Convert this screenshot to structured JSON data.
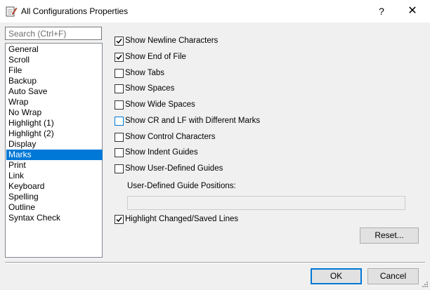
{
  "window": {
    "title": "All Configurations Properties",
    "help_glyph": "?",
    "close_glyph": "✕",
    "app_icon": "notepad-pencil-icon"
  },
  "search": {
    "placeholder": "Search (Ctrl+F)",
    "value": ""
  },
  "categories": {
    "items": [
      "General",
      "Scroll",
      "File",
      "Backup",
      "Auto Save",
      "Wrap",
      "No Wrap",
      "Highlight (1)",
      "Highlight (2)",
      "Display",
      "Marks",
      "Print",
      "Link",
      "Keyboard",
      "Spelling",
      "Outline",
      "Syntax Check"
    ],
    "selected": "Marks"
  },
  "options": [
    {
      "label": "Show Newline Characters",
      "checked": true
    },
    {
      "label": "Show End of File",
      "checked": true
    },
    {
      "label": "Show Tabs",
      "checked": false
    },
    {
      "label": "Show Spaces",
      "checked": false
    },
    {
      "label": "Show Wide Spaces",
      "checked": false
    },
    {
      "label": "Show CR and LF with Different Marks",
      "checked": false,
      "hover": true
    },
    {
      "label": "Show Control Characters",
      "checked": false
    },
    {
      "label": "Show Indent Guides",
      "checked": false
    },
    {
      "label": "Show User-Defined Guides",
      "checked": false
    }
  ],
  "guide_positions": {
    "label": "User-Defined Guide Positions:",
    "value": "",
    "enabled": false
  },
  "highlight_changed": {
    "label": "Highlight Changed/Saved Lines",
    "checked": true
  },
  "buttons": {
    "reset": "Reset...",
    "ok": "OK",
    "cancel": "Cancel"
  },
  "colors": {
    "selection": "#0078d7",
    "button_face": "#e1e1e1",
    "dialog_bg": "#f0f0f0"
  }
}
